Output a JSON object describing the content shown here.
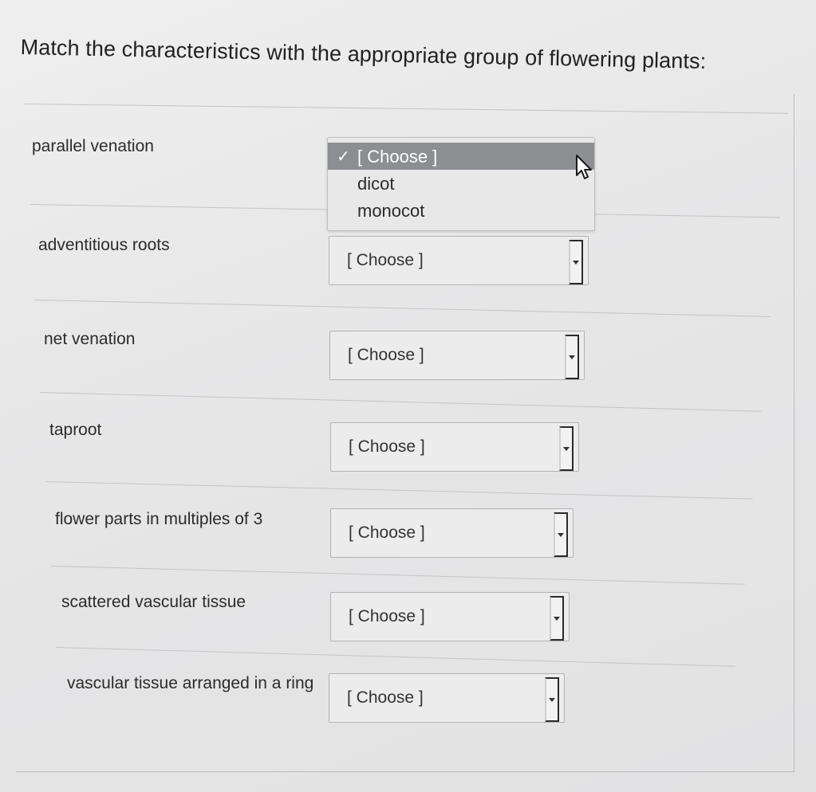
{
  "question": "Match the characteristics with the appropriate group of flowering plants:",
  "rows": [
    {
      "label": "parallel venation",
      "value": "[ Choose ]"
    },
    {
      "label": "adventitious roots",
      "value": "[ Choose ]"
    },
    {
      "label": "net venation",
      "value": "[ Choose ]"
    },
    {
      "label": "taproot",
      "value": "[ Choose ]"
    },
    {
      "label": "flower parts in multiples of 3",
      "value": "[ Choose ]"
    },
    {
      "label": "scattered vascular tissue",
      "value": "[ Choose ]"
    },
    {
      "label": "vascular tissue arranged in a ring",
      "value": "[ Choose ]"
    }
  ],
  "dropdown": {
    "check": "✓",
    "options": [
      "[ Choose ]",
      "dicot",
      "monocot"
    ]
  },
  "icons": {
    "checkmark": "check-icon",
    "cursor": "mouse-pointer-icon",
    "select_arrow": "chevron-down-icon"
  }
}
